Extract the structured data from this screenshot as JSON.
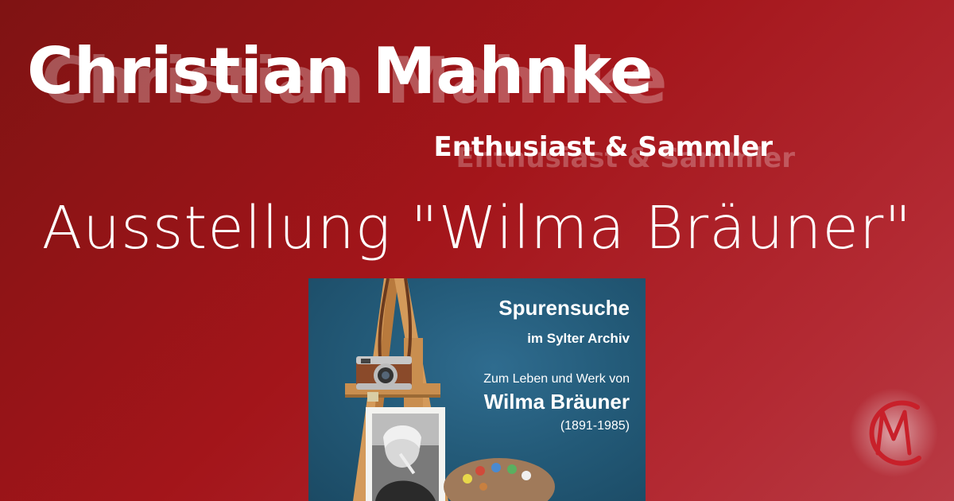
{
  "header": {
    "title": "Christian Mahnke",
    "subtitle": "Enthusiast & Sammler"
  },
  "main": {
    "headline": "Ausstellung \"Wilma Bräuner\"",
    "poster": {
      "line1": "Spurensuche",
      "line2": "im Sylter Archiv",
      "line3": "Zum Leben und Werk von",
      "line4": "Wilma Bräuner",
      "line5": "(1891-1985)"
    }
  },
  "colors": {
    "background": "#a3151a",
    "poster_background": "#235a78",
    "text": "#ffffff"
  },
  "icons": {
    "logo": "cm-monogram-icon"
  }
}
